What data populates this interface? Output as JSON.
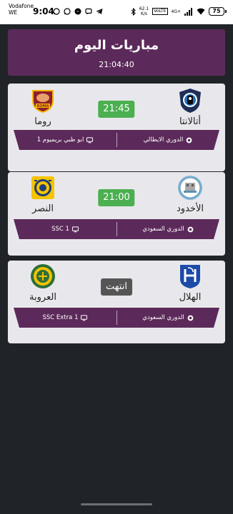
{
  "status_bar": {
    "carrier_line1": "Vodafone",
    "carrier_line2": "WE",
    "clock": "9:04",
    "net_speed": "62.1",
    "net_unit": "K/s",
    "volte": "VoLTE",
    "net_type": "4G+",
    "battery": "75"
  },
  "header": {
    "title": "مباريات اليوم",
    "time": "21:04:40"
  },
  "colors": {
    "primary": "#5c2a5a",
    "time_badge": "#4caf50",
    "ended_badge": "#555555",
    "card_bg": "#e8e8ec",
    "background": "#202428"
  },
  "matches": [
    {
      "home_team": "أتالانتا",
      "home_logo": "atalanta-logo",
      "away_team": "روما",
      "away_logo": "roma-logo",
      "status": "21:45",
      "league": "الدوري الايطالي",
      "channel": "ابو ظبي بريميوم 1"
    },
    {
      "home_team": "الأخدود",
      "home_logo": "alakhdoud-logo",
      "away_team": "النصر",
      "away_logo": "alnassr-logo",
      "status": "21:00",
      "league": "الدوري السعودي",
      "channel": "SSC 1"
    },
    {
      "home_team": "الهلال",
      "home_logo": "alhilal-logo",
      "away_team": "العروبة",
      "away_logo": "aloruba-logo",
      "status": "انتهت",
      "league": "الدوري السعودي",
      "channel": "SSC Extra 1"
    }
  ]
}
